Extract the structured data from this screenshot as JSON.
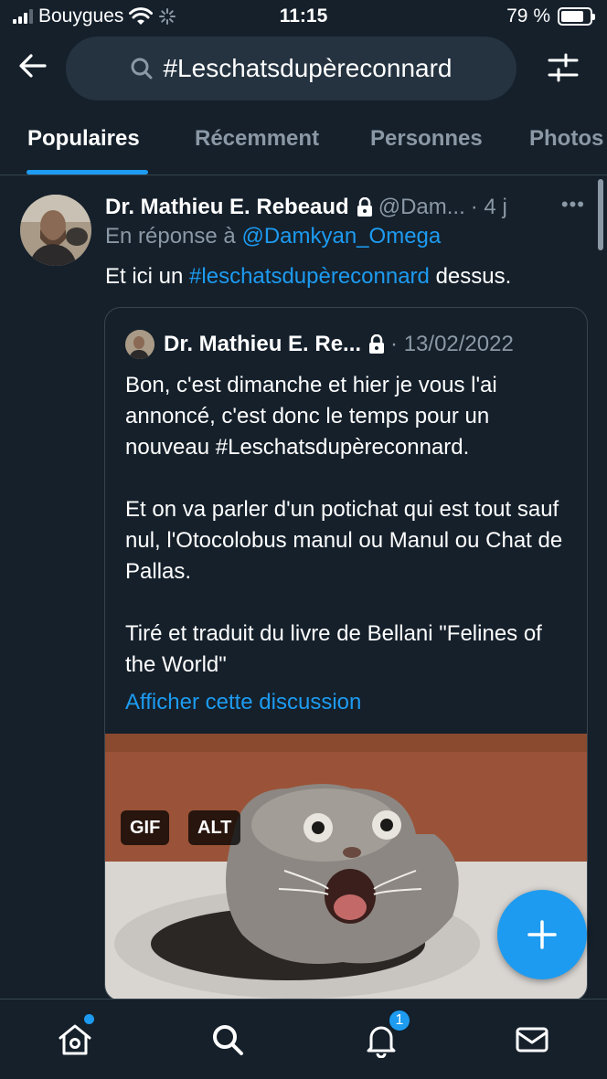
{
  "status_bar": {
    "carrier": "Bouygues",
    "time": "11:15",
    "battery_percent": "79 %",
    "battery_level": 0.79
  },
  "header": {
    "search_query": "#Leschatsdupèreconnard",
    "back_icon": "arrow-left-icon",
    "filter_icon": "sliders-icon"
  },
  "tabs": [
    {
      "label": "Populaires",
      "active": true
    },
    {
      "label": "Récemment",
      "active": false
    },
    {
      "label": "Personnes",
      "active": false
    },
    {
      "label": "Photos",
      "active": false
    }
  ],
  "tweet": {
    "author_name": "Dr. Mathieu E. Rebeaud",
    "author_handle": "@Dam...",
    "time_ago": "· 4 j",
    "more": "•••",
    "reply_prefix": "En réponse à",
    "reply_to": "@Damkyan_Omega",
    "text_before": "Et ici un",
    "hashtag": "#leschatsdupèreconnard",
    "text_after": "dessus.",
    "quote": {
      "author_name": "Dr. Mathieu E. Re...",
      "date": "· 13/02/2022",
      "paragraph_1": "Bon, c'est dimanche et hier je vous l'ai annoncé, c'est donc le temps pour un nouveau #Leschatsdupèreconnard.",
      "paragraph_2": "Et on va parler d'un potichat qui est tout sauf nul, l'Otocolobus manul ou Manul ou Chat de Pallas.",
      "paragraph_3": "Tiré et traduit du livre de Bellani \"Felines of the World\"",
      "show_thread": "Afficher cette discussion",
      "badges": [
        "GIF",
        "ALT"
      ]
    }
  },
  "colors": {
    "background": "#15202b",
    "accent": "#1d9bf0",
    "muted": "#8b98a5",
    "search_bg": "#253341"
  },
  "bottom_nav": {
    "items": [
      "home-icon",
      "search-icon",
      "bell-icon",
      "mail-icon"
    ],
    "notification_count": "1"
  }
}
